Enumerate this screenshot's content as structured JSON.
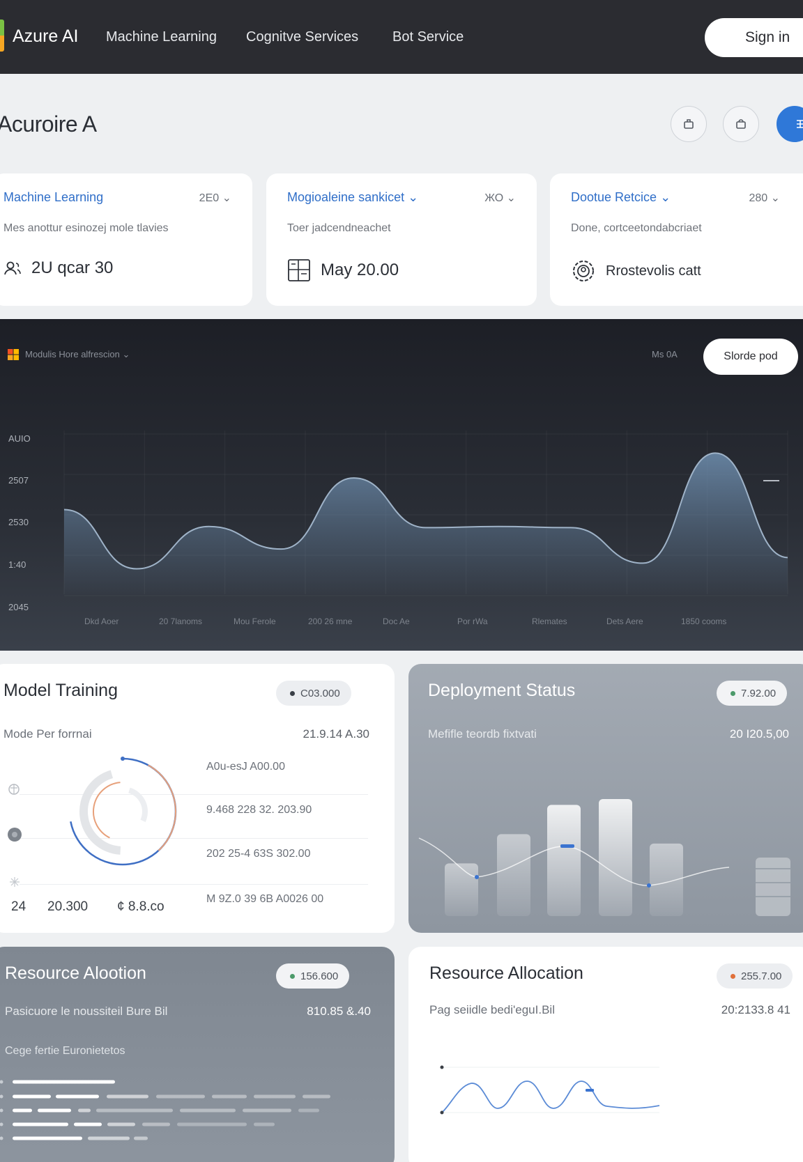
{
  "nav": {
    "brand": "Azure AI",
    "links": [
      "Machine Learning",
      "Cognitve Services",
      "Bot Service"
    ],
    "signin": "Sign in"
  },
  "header": {
    "title": "Acuroire A"
  },
  "service_cards": [
    {
      "name": "Machine Learning",
      "count": "2E0 ⌄",
      "desc": "Mes anottur esinozej mole tlavies",
      "metric": "2U qcar 30",
      "icon": "user-group-icon"
    },
    {
      "name": "Mogioaleine sankicet ⌄",
      "count": "ЖО ⌄",
      "desc": "Toer jadcendneachet",
      "metric": "May 20.00",
      "icon": "layout-icon"
    },
    {
      "name": "Dootue Retcice ⌄",
      "count": "280 ⌄",
      "desc": "Done, cortceetondabcriaet",
      "metric": "Rrostevolis catt",
      "icon": "settings-gear-icon"
    }
  ],
  "chart_panel": {
    "legend": "Modulis Hore alfrescion ⌄",
    "meta": "Ms 0A",
    "button": "Slorde pod",
    "colors": {
      "accent": "#6f8fb0"
    }
  },
  "chart_data": {
    "type": "area",
    "y_ticks": [
      "AUIO",
      "2507",
      "2530",
      "1:40",
      "2045"
    ],
    "x_labels": [
      "Dkd Aoer",
      "20 7lanoms",
      "Mou Ferole",
      "200 26 mne",
      "Doc Ae",
      "Por rWa",
      "Rlemates",
      "Dets Aere",
      "1850 cooms"
    ],
    "x": [
      0,
      1,
      2,
      3,
      4,
      5,
      6,
      7,
      8,
      9,
      10
    ],
    "values": [
      2500,
      2395,
      2470,
      2430,
      2556,
      2468,
      2470,
      2468,
      2405,
      2600,
      2415
    ],
    "grid": true
  },
  "model_training": {
    "title": "Model Training",
    "badge": "C03.000",
    "sub": "Mode Per forrnai",
    "value": "21.9.14 A.30",
    "rows": [
      "A0u-esJ A00.00",
      "9.468 228 32. 203.90",
      "202 25-4 63S 302.00",
      "M 9Z.0 39 6B A0026 00"
    ],
    "footer": [
      "24",
      "20.300",
      "¢ 8.8.co"
    ],
    "ring_progress": 0.72
  },
  "deployment_status": {
    "title": "Deployment Status",
    "badge": "7.92.00",
    "sub": "Mefifle teordb fixtvati",
    "value": "20 I20.5,00",
    "bar_levels": [
      0.45,
      0.7,
      0.95,
      1.0,
      0.62
    ]
  },
  "resource_alootion": {
    "title": "Resource Alootion",
    "badge": "156.600",
    "sub": "Pasicuore le noussiteil Bure Bil",
    "value": "810.85 &.40",
    "sub2": "Cege fertie Euronietetos"
  },
  "resource_allocation": {
    "title": "Resource Allocation",
    "badge": "255.7.00",
    "sub": "Pag seiidle bedi'eguI.Bil",
    "value": "20:2133.8 41"
  }
}
